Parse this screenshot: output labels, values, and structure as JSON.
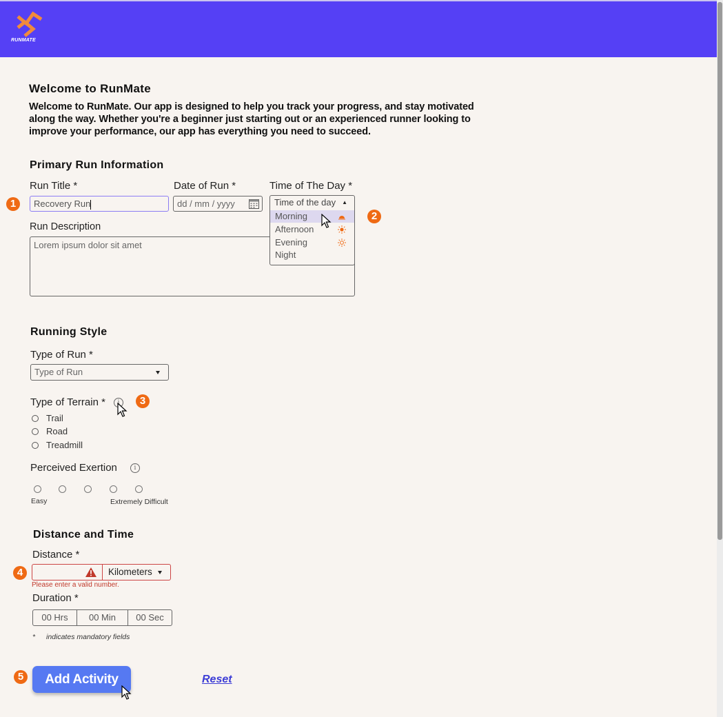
{
  "header": {
    "brand": "RUNMATE",
    "color": "#5540f5"
  },
  "welcome": {
    "title": "Welcome to RunMate",
    "text": "Welcome to RunMate. Our app is designed to help you track your progress, and stay motivated along the way. Whether you're a beginner just starting out or an experienced runner looking to improve your performance, our app has everything you need to succeed."
  },
  "primary": {
    "title": "Primary Run Information",
    "run_title_label": "Run Title *",
    "run_title_value": "Recovery Run",
    "date_label": "Date of Run *",
    "date_placeholder": "dd / mm / yyyy",
    "time_label": "Time of The Day *",
    "time_placeholder": "Time of the day",
    "time_options": [
      {
        "label": "Morning",
        "icon": "sunrise-icon"
      },
      {
        "label": "Afternoon",
        "icon": "sun-icon"
      },
      {
        "label": "Evening",
        "icon": "sun-outline-icon"
      },
      {
        "label": "Night",
        "icon": "moon-icon"
      }
    ],
    "desc_label": "Run Description",
    "desc_value": "Lorem ipsum dolor sit amet"
  },
  "style": {
    "title": "Running Style",
    "type_label": "Type of Run *",
    "type_placeholder": "Type of Run",
    "terrain_label": "Type of Terrain *",
    "terrain_options": [
      "Trail",
      "Road",
      "Treadmill"
    ],
    "exertion_label": "Perceived Exertion",
    "exertion_min": "Easy",
    "exertion_max": "Extremely Difficult",
    "exertion_levels": 5
  },
  "distance": {
    "title": "Distance and Time",
    "distance_label": "Distance *",
    "unit": "Kilometers",
    "error": "Please enter a valid number.",
    "duration_label": "Duration *",
    "hrs": "00 Hrs",
    "min": "00 Min",
    "sec": "00 Sec",
    "mandatory_star": "*",
    "mandatory_note": "indicates mandatory fields"
  },
  "actions": {
    "add": "Add Activity",
    "reset": "Reset"
  },
  "markers": [
    "1",
    "2",
    "3",
    "4",
    "5"
  ],
  "colors": {
    "accent": "#5679f2",
    "marker": "#ef6a14",
    "error": "#c0392b"
  }
}
